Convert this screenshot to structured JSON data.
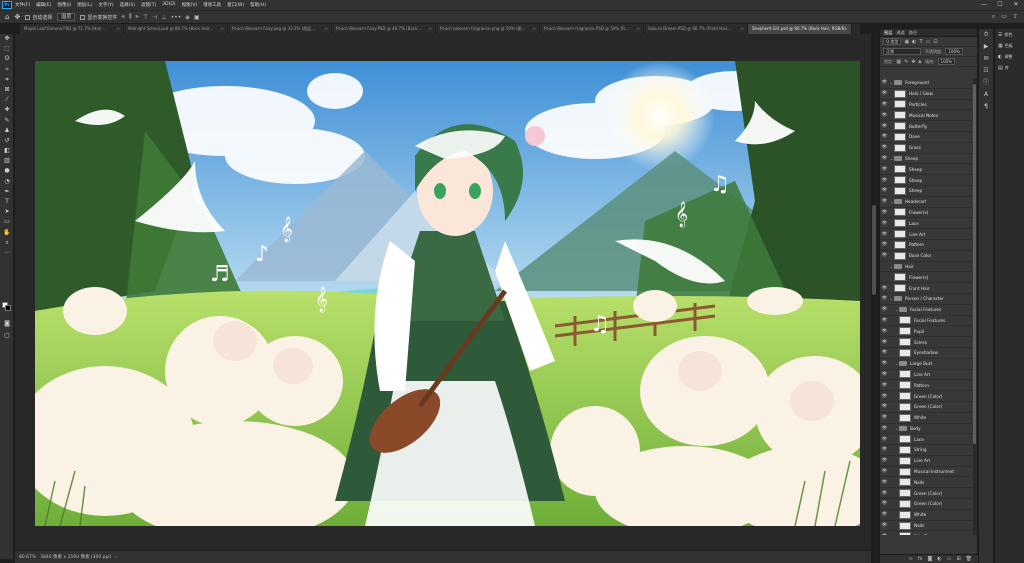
{
  "app": {
    "logo": "Ps"
  },
  "menu": [
    "文件(F)",
    "编辑(E)",
    "图像(I)",
    "图层(L)",
    "文字(Y)",
    "选择(S)",
    "滤镜(T)",
    "3D(D)",
    "视图(V)",
    "增效工具",
    "窗口(W)",
    "帮助(H)"
  ],
  "window_controls": [
    "—",
    "☐",
    "✕"
  ],
  "options": {
    "auto_select_label": "自动选择",
    "auto_select_target": "图层",
    "transform_controls_label": "显示变换控件",
    "dots": "•••"
  },
  "tabs": [
    {
      "label": "Maple Leaf Kimono.PSD @ 71.7% (Hair...",
      "active": false
    },
    {
      "label": "Midnight School.psd @ 80.7% (Back Hair...",
      "active": false
    },
    {
      "label": "Peach Blossom Fairy.png @ 33.3% (图层...",
      "active": false
    },
    {
      "label": "Peach Blossom Fairy.PSD @ 46.7% (Back...",
      "active": false
    },
    {
      "label": "Peach blossom fragrance.png @ 50% (图...",
      "active": false
    },
    {
      "label": "Peach Blossom fragrance.PSD @ 50% (R...",
      "active": false
    },
    {
      "label": "Sakura Dream.PSD @ 66.7% (Front Hair...",
      "active": false
    },
    {
      "label": "Shepherd Girl.psd @ 80.7% (Back Hair, RGB/8)",
      "active": true
    }
  ],
  "status": {
    "zoom": "80.67%",
    "doc_size": "3840 像素 x 2160 像素 (300 ppi)"
  },
  "layers_panel": {
    "tabs": [
      "图层",
      "通道",
      "路径"
    ],
    "kind_filter": "Q 类型",
    "blend_mode": "正常",
    "opacity_label": "不透明度:",
    "opacity_value": "100%",
    "lock_label": "锁定:",
    "fill_label": "填充:",
    "fill_value": "100%",
    "layers": [
      {
        "name": "Foreground",
        "type": "group",
        "indent": 0,
        "visible": true
      },
      {
        "name": "Halo / Glow",
        "type": "layer",
        "indent": 1,
        "visible": true
      },
      {
        "name": "Particles",
        "type": "layer",
        "indent": 1,
        "visible": true
      },
      {
        "name": "Musical Notes",
        "type": "layer",
        "indent": 1,
        "visible": true
      },
      {
        "name": "Butterfly",
        "type": "layer",
        "indent": 1,
        "visible": true
      },
      {
        "name": "Dove",
        "type": "layer",
        "indent": 1,
        "visible": true
      },
      {
        "name": "Grass",
        "type": "layer",
        "indent": 1,
        "visible": true
      },
      {
        "name": "Sheep",
        "type": "group",
        "indent": 0,
        "visible": true
      },
      {
        "name": "Sheep",
        "type": "layer",
        "indent": 1,
        "visible": true
      },
      {
        "name": "Sheep",
        "type": "layer",
        "indent": 1,
        "visible": true
      },
      {
        "name": "Sheep",
        "type": "layer",
        "indent": 1,
        "visible": true
      },
      {
        "name": "Headscarf",
        "type": "group",
        "indent": 0,
        "visible": true
      },
      {
        "name": "Flower(s)",
        "type": "layer",
        "indent": 1,
        "visible": true
      },
      {
        "name": "Lace",
        "type": "layer",
        "indent": 1,
        "visible": true
      },
      {
        "name": "Line Art",
        "type": "layer",
        "indent": 1,
        "visible": true
      },
      {
        "name": "Pattern",
        "type": "layer",
        "indent": 1,
        "visible": true
      },
      {
        "name": "Base Color",
        "type": "layer",
        "indent": 1,
        "visible": true
      },
      {
        "name": "Hair",
        "type": "group",
        "indent": 0,
        "visible": false
      },
      {
        "name": "Flower(s)",
        "type": "layer",
        "indent": 1,
        "visible": false
      },
      {
        "name": "Front Hair",
        "type": "layer",
        "indent": 1,
        "visible": true
      },
      {
        "name": "Person / Character",
        "type": "group",
        "indent": 0,
        "visible": true
      },
      {
        "name": "Facial Features",
        "type": "group",
        "indent": 1,
        "visible": true
      },
      {
        "name": "Facial Features",
        "type": "layer",
        "indent": 2,
        "visible": true
      },
      {
        "name": "Pupil",
        "type": "layer",
        "indent": 2,
        "visible": true
      },
      {
        "name": "Sclera",
        "type": "layer",
        "indent": 2,
        "visible": true
      },
      {
        "name": "Eyeshadow",
        "type": "layer",
        "indent": 2,
        "visible": true
      },
      {
        "name": "Large Bust",
        "type": "group",
        "indent": 1,
        "visible": true
      },
      {
        "name": "Line Art",
        "type": "layer",
        "indent": 2,
        "visible": true
      },
      {
        "name": "Pattern",
        "type": "layer",
        "indent": 2,
        "visible": true
      },
      {
        "name": "Green (Color)",
        "type": "layer",
        "indent": 2,
        "visible": true
      },
      {
        "name": "Green (Color)",
        "type": "layer",
        "indent": 2,
        "visible": true
      },
      {
        "name": "White",
        "type": "layer",
        "indent": 2,
        "visible": true
      },
      {
        "name": "Body",
        "type": "group",
        "indent": 1,
        "visible": true
      },
      {
        "name": "Lace",
        "type": "layer",
        "indent": 2,
        "visible": true
      },
      {
        "name": "String",
        "type": "layer",
        "indent": 2,
        "visible": true
      },
      {
        "name": "Line Art",
        "type": "layer",
        "indent": 2,
        "visible": true
      },
      {
        "name": "Musical Instrument",
        "type": "layer",
        "indent": 2,
        "visible": true
      },
      {
        "name": "Nails",
        "type": "layer",
        "indent": 2,
        "visible": true
      },
      {
        "name": "Green (Color)",
        "type": "layer",
        "indent": 2,
        "visible": true
      },
      {
        "name": "Green (Color)",
        "type": "layer",
        "indent": 2,
        "visible": true
      },
      {
        "name": "White",
        "type": "layer",
        "indent": 2,
        "visible": true
      },
      {
        "name": "Nails",
        "type": "layer",
        "indent": 2,
        "visible": true
      },
      {
        "name": "Skin Tone",
        "type": "layer",
        "indent": 2,
        "visible": true
      }
    ]
  },
  "right_panels": [
    {
      "icon": "☰",
      "label": "颜色"
    },
    {
      "icon": "▦",
      "label": "色板"
    },
    {
      "icon": "◐",
      "label": "调整"
    },
    {
      "icon": "▤",
      "label": "库"
    }
  ],
  "colors": {
    "accent": "#31a8ff",
    "ui_bg": "#323232",
    "panel_bg": "#383838",
    "canvas_bg": "#282828"
  }
}
